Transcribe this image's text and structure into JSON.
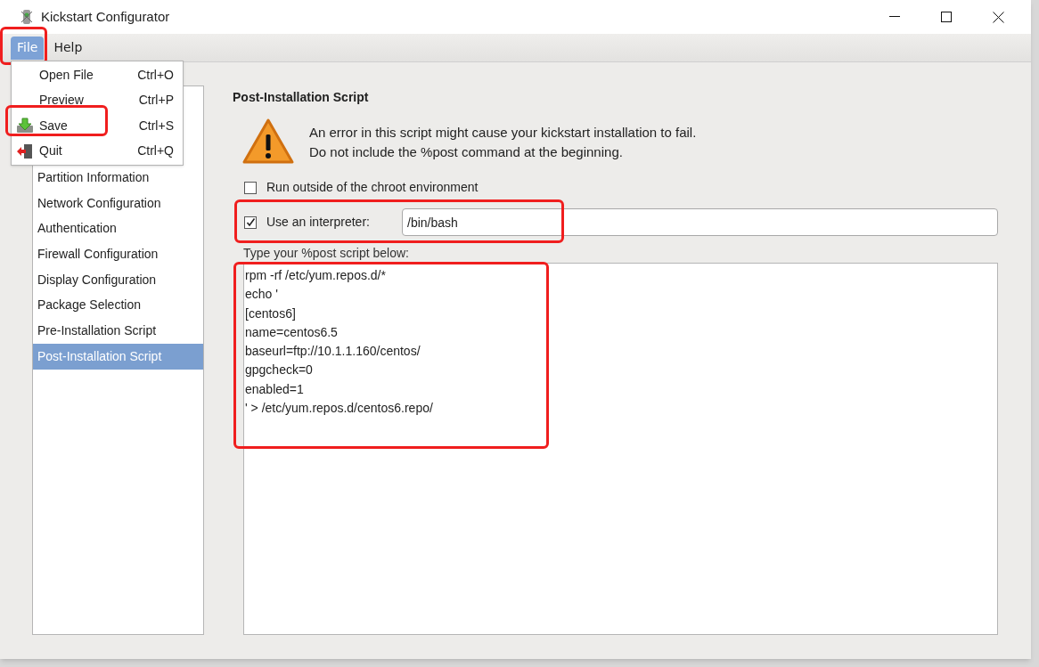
{
  "window": {
    "title": "Kickstart Configurator"
  },
  "menu_bar": [
    {
      "label": "File",
      "selected": true,
      "highlighted": true
    },
    {
      "label": "Help",
      "selected": false,
      "highlighted": false
    }
  ],
  "file_menu": [
    {
      "label": "Open File",
      "shortcut": "Ctrl+O",
      "kind": "plain",
      "highlighted": false
    },
    {
      "label": "Preview",
      "shortcut": "Ctrl+P",
      "kind": "plain",
      "highlighted": false
    },
    {
      "label": "Save",
      "shortcut": "Ctrl+S",
      "kind": "save",
      "highlighted": true
    },
    {
      "label": "Quit",
      "shortcut": "Ctrl+Q",
      "kind": "quit",
      "highlighted": false
    }
  ],
  "sidebar": {
    "items": [
      {
        "label": "Partition Information",
        "selected": false
      },
      {
        "label": "Network Configuration",
        "selected": false
      },
      {
        "label": "Authentication",
        "selected": false
      },
      {
        "label": "Firewall Configuration",
        "selected": false
      },
      {
        "label": "Display Configuration",
        "selected": false
      },
      {
        "label": "Package Selection",
        "selected": false
      },
      {
        "label": "Pre-Installation Script",
        "selected": false
      },
      {
        "label": "Post-Installation Script",
        "selected": true
      }
    ]
  },
  "panel": {
    "title": "Post-Installation Script",
    "warning": "An error in this script might cause your kickstart installation to fail. Do not include the %post command at the beginning.",
    "chroot": {
      "label": "Run outside of the chroot environment",
      "checked": false
    },
    "interpreter": {
      "label": "Use an interpreter:",
      "checked": true,
      "value": "/bin/bash",
      "highlighted": true
    },
    "script_label": "Type your %post script below:",
    "script": {
      "lines": [
        "rpm -rf /etc/yum.repos.d/*",
        "echo '",
        "[centos6]",
        "name=centos6.5",
        "baseurl=ftp://10.1.1.160/centos/",
        "gpgcheck=0",
        "enabled=1",
        "' > /etc/yum.repos.d/centos6.repo/"
      ],
      "highlighted": true
    }
  }
}
